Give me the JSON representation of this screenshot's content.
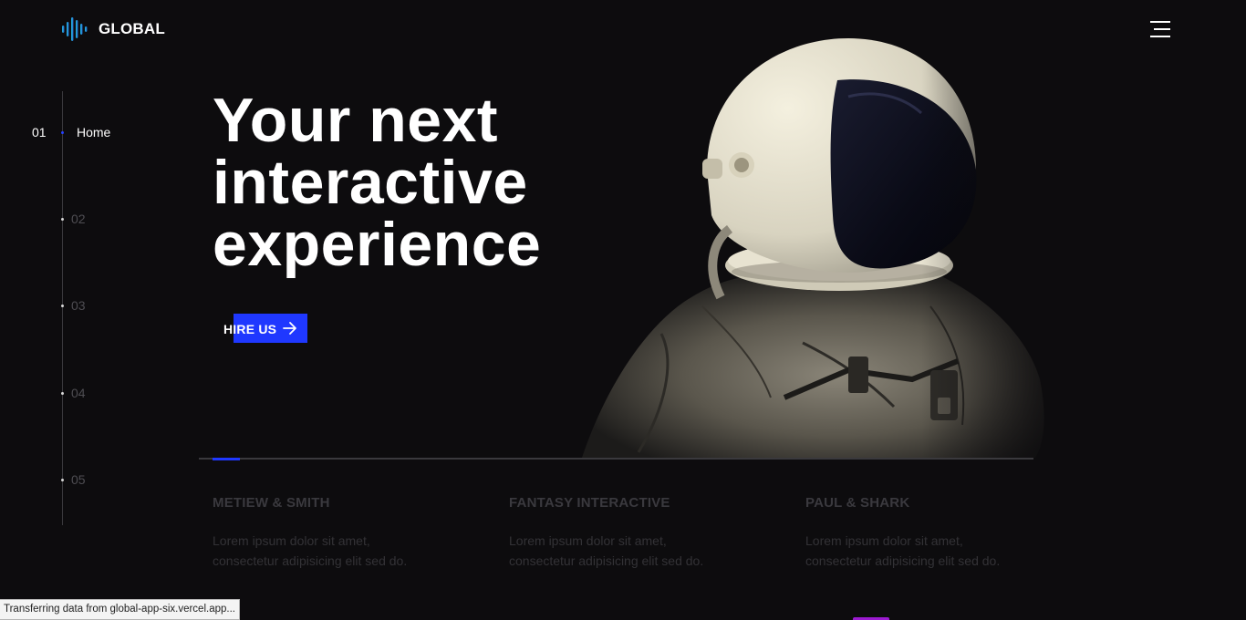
{
  "header": {
    "logo_text": "GLOBAL",
    "logo_icon": "sound-bars-icon",
    "menu_icon": "hamburger-icon"
  },
  "side_nav": {
    "items": [
      {
        "number": "01",
        "label": "Home",
        "active": true
      },
      {
        "number": "02",
        "label": "",
        "active": false
      },
      {
        "number": "03",
        "label": "",
        "active": false
      },
      {
        "number": "04",
        "label": "",
        "active": false
      },
      {
        "number": "05",
        "label": "",
        "active": false
      }
    ]
  },
  "hero": {
    "title_lines": [
      "Your next",
      "interactive",
      "experience"
    ],
    "cta_label": "HIRE US",
    "cta_icon": "arrow-right-icon",
    "image": "astronaut-illustration"
  },
  "slider": {
    "progress": 0.033
  },
  "clients": [
    {
      "name": "METIEW & SMITH",
      "description": "Lorem ipsum dolor sit amet, consectetur adipisicing elit sed do."
    },
    {
      "name": "FANTASY INTERACTIVE",
      "description": "Lorem ipsum dolor sit amet, consectetur adipisicing elit sed do."
    },
    {
      "name": "PAUL & SHARK",
      "description": "Lorem ipsum dolor sit amet, consectetur adipisicing elit sed do."
    }
  ],
  "status_bar": {
    "text": "Transferring data from global-app-six.vercel.app..."
  },
  "colors": {
    "background": "#0d0c0e",
    "accent": "#1f38ff",
    "text": "#ffffff",
    "muted": "#3a393e"
  }
}
